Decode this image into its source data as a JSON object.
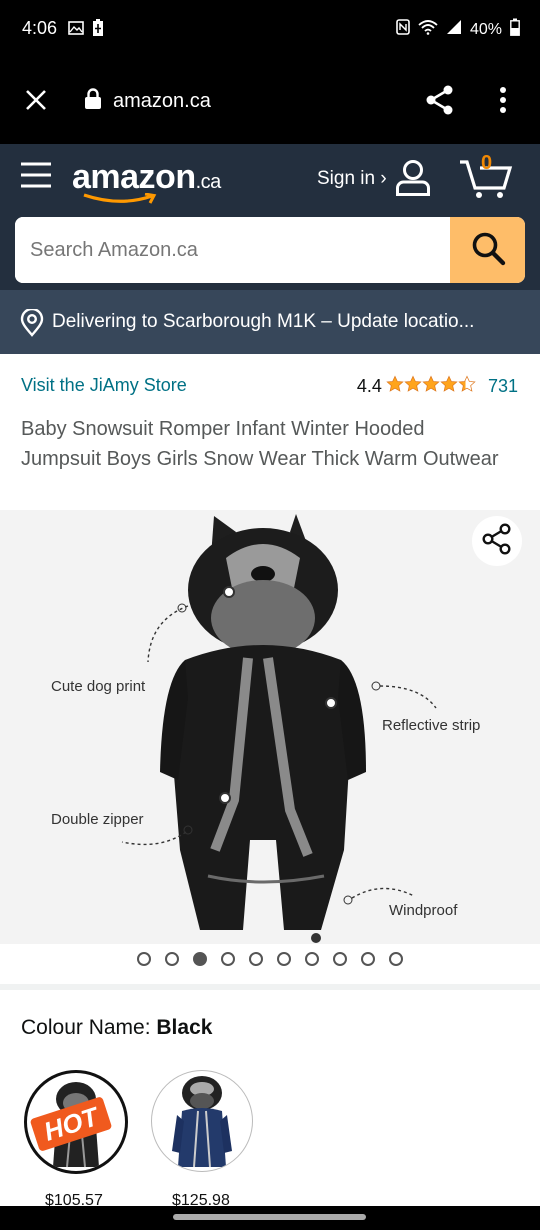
{
  "status": {
    "time": "4:06",
    "battery": "40%"
  },
  "browser": {
    "url": "amazon.ca"
  },
  "header": {
    "logo_main": "amazon",
    "logo_suffix": ".ca",
    "sign_in": "Sign in ›",
    "cart_count": "0"
  },
  "search": {
    "placeholder": "Search Amazon.ca",
    "value": ""
  },
  "delivery": {
    "text": "Delivering to Scarborough M1K – Update locatio..."
  },
  "product": {
    "store": "Visit the JiAmy Store",
    "rating": "4.4",
    "stars": 4.4,
    "rating_count": "731",
    "title": "Baby Snowsuit Romper Infant Winter Hooded Jumpsuit Boys Girls Snow Wear Thick Warm Outwear",
    "callouts": {
      "dog": "Cute dog print",
      "reflective": "Reflective strip",
      "zipper": "Double zipper",
      "windproof": "Windproof"
    }
  },
  "carousel": {
    "count": 10,
    "active_index": 2
  },
  "colour": {
    "label": "Colour Name: ",
    "selected": "Black",
    "options": [
      {
        "price": "$105.57",
        "badge": "HOT",
        "color": "#222222"
      },
      {
        "price": "$125.98",
        "color": "#233a6b"
      }
    ]
  },
  "icons": [
    "close-icon",
    "lock-icon",
    "share-icon",
    "more-icon",
    "menu-icon",
    "user-icon",
    "cart-icon",
    "search-icon",
    "location-icon",
    "star-icon"
  ],
  "colors": {
    "header": "#232f3e",
    "delivery": "#37475a",
    "search_button": "#febd69",
    "link": "#007185",
    "star": "#ffa41c",
    "cart_count": "#f08804"
  }
}
